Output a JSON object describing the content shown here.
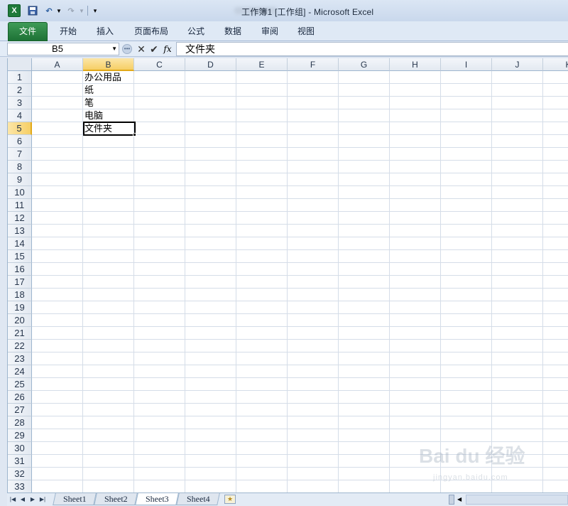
{
  "window": {
    "title": "工作簿1  [工作组]  -  Microsoft Excel",
    "app_icon": "excel-icon"
  },
  "quick_access": {
    "save_icon": "save-icon",
    "undo_icon": "undo-icon",
    "redo_icon": "redo-icon"
  },
  "ribbon": {
    "tabs": [
      "文件",
      "开始",
      "插入",
      "页面布局",
      "公式",
      "数据",
      "审阅",
      "视图"
    ],
    "file_color": "#2a8043"
  },
  "formula_bar": {
    "name_box": "B5",
    "value": "文件夹"
  },
  "grid": {
    "columns": [
      "A",
      "B",
      "C",
      "D",
      "E",
      "F",
      "G",
      "H",
      "I",
      "J",
      "K"
    ],
    "rows": [
      "1",
      "2",
      "3",
      "4",
      "5",
      "6",
      "7",
      "8",
      "9",
      "10",
      "11",
      "12",
      "13",
      "14",
      "15",
      "16",
      "17",
      "18",
      "19",
      "20",
      "21",
      "22",
      "23",
      "24",
      "25",
      "26",
      "27",
      "28",
      "29",
      "30",
      "31",
      "32",
      "33"
    ],
    "selected_column": "B",
    "selected_row": "5",
    "cells": {
      "B1": "办公用品",
      "B2": "纸",
      "B3": "笔",
      "B4": "电脑",
      "B5": "文件夹"
    }
  },
  "sheets": {
    "tabs": [
      "Sheet1",
      "Sheet2",
      "Sheet3",
      "Sheet4"
    ],
    "active": "Sheet3"
  },
  "watermark": {
    "text": "Bai du 经验",
    "sub": "jingyan.baidu.com"
  }
}
